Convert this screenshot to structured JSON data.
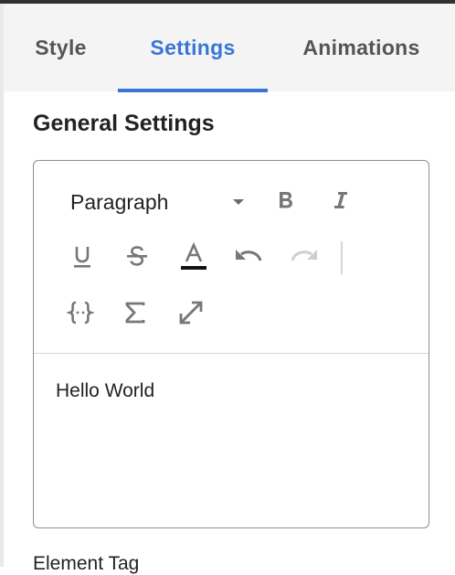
{
  "tabs": [
    {
      "label": "Style"
    },
    {
      "label": "Settings",
      "active": true
    },
    {
      "label": "Animations"
    }
  ],
  "section_title": "General Settings",
  "editor": {
    "block_format": "Paragraph",
    "toolbar": {
      "row1": [
        "bold-icon",
        "italic-icon"
      ],
      "row2": [
        "underline-icon",
        "strikethrough-icon",
        "text-color-icon",
        "undo-icon",
        "redo-icon"
      ],
      "row3": [
        "code-braces-icon",
        "sigma-icon",
        "fullscreen-icon"
      ],
      "redo_enabled": false
    },
    "content": "Hello World"
  },
  "next_field_label": "Element Tag",
  "colors": {
    "accent": "#3a76d6",
    "text_color_swatch": "#111111",
    "topbar": "#2e3033"
  }
}
